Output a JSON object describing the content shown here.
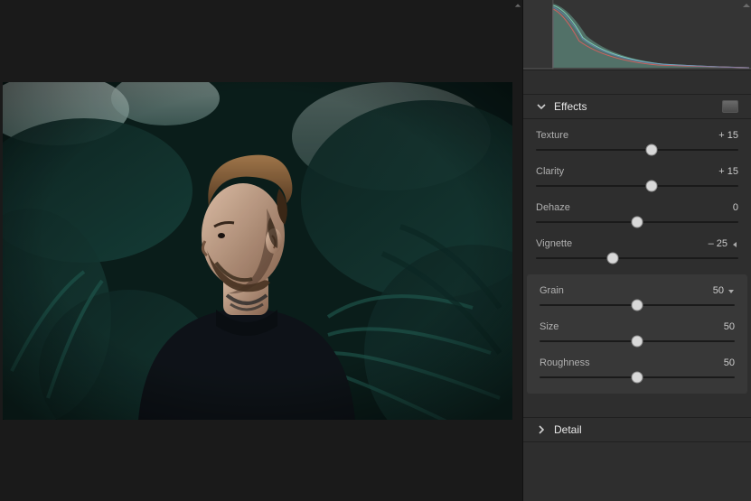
{
  "canvas": {
    "subject": "Bearded man with short quiff haircut looking left, dark sweater, neck tattoos, standing among dark teal tropical foliage"
  },
  "histogram": {
    "description": "RGB histogram heavily weighted to shadows, steep falloff toward highlights"
  },
  "panels": {
    "effects": {
      "title": "Effects",
      "expanded": true,
      "sliders": [
        {
          "key": "texture",
          "label": "Texture",
          "value": "+ 15",
          "pos": 57
        },
        {
          "key": "clarity",
          "label": "Clarity",
          "value": "+ 15",
          "pos": 57
        },
        {
          "key": "dehaze",
          "label": "Dehaze",
          "value": "0",
          "pos": 50
        },
        {
          "key": "vignette",
          "label": "Vignette",
          "value": "– 25",
          "pos": 38,
          "leftArrow": true
        }
      ],
      "grain_group": [
        {
          "key": "grain",
          "label": "Grain",
          "value": "50",
          "pos": 50,
          "dropdown": true
        },
        {
          "key": "size",
          "label": "Size",
          "value": "50",
          "pos": 50
        },
        {
          "key": "roughness",
          "label": "Roughness",
          "value": "50",
          "pos": 50
        }
      ]
    },
    "detail": {
      "title": "Detail",
      "expanded": false
    }
  }
}
